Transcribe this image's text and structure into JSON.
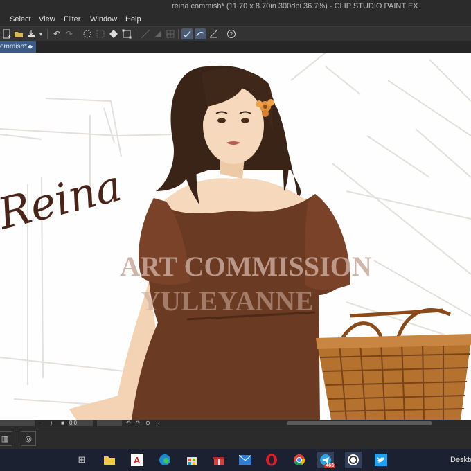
{
  "window": {
    "title": "reina commish* (11.70 x 8.70in 300dpi 36.7%)  - CLIP STUDIO PAINT EX"
  },
  "menu": {
    "items": [
      "Select",
      "View",
      "Filter",
      "Window",
      "Help"
    ]
  },
  "tab": {
    "label": "ommish*",
    "close_glyph": "◆"
  },
  "canvas": {
    "signature": "Reina",
    "watermark_line1": "ART COMMISSION",
    "watermark_line2": "YULEYANNE",
    "colors": {
      "dress": "#6b3a22",
      "hair": "#3a2418",
      "skin": "#f6d9bc",
      "basket": "#b5722f",
      "watermark": "#c8a89a"
    }
  },
  "statusbar": {
    "zoom": "0.0"
  },
  "taskbar": {
    "telegram_badge": "463",
    "show_desktop": "Deskto",
    "apps": [
      "task-view",
      "file-explorer",
      "adobe-acrobat",
      "edge",
      "store",
      "gift",
      "mail",
      "opera",
      "chrome",
      "telegram",
      "line",
      "twitter"
    ]
  }
}
